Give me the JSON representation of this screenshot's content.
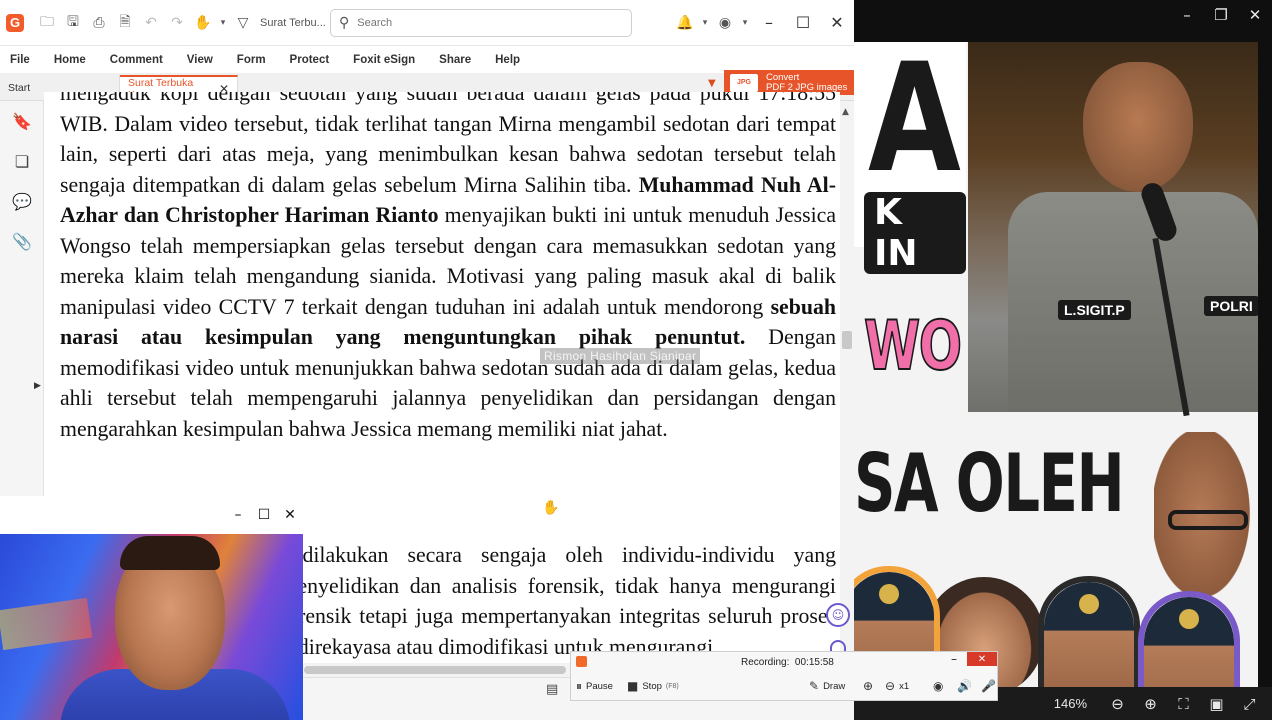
{
  "foxit": {
    "logo": "G",
    "doc_title": "Surat Terbu...",
    "search_placeholder": "Search",
    "menu": [
      "File",
      "Home",
      "Comment",
      "View",
      "Form",
      "Protect",
      "Foxit eSign",
      "Share",
      "Help"
    ],
    "tabs": {
      "start": "Start",
      "active": "Surat Terbuka Kep..."
    },
    "convert": {
      "line1": "Convert",
      "line2": "PDF 2 JPG images",
      "jpg_badge": "JPG"
    },
    "accent_color": "#e8542a"
  },
  "document": {
    "p1": [
      {
        "t": "mengaduk kopi dengan sedotan yang sudah berada dalam gelas pada pukul 17:18:55 WIB. Dalam video tersebut, tidak terlihat tangan Mirna mengambil sedotan dari tempat lain, seperti dari atas meja, yang menimbulkan kesan bahwa sedotan tersebut telah sengaja ditempatkan di dalam gelas sebelum Mirna Salihin tiba. ",
        "b": false
      },
      {
        "t": "Muhammad Nuh Al-Azhar dan Christopher Hariman Rianto",
        "b": true
      },
      {
        "t": " menyajikan bukti ini untuk menuduh Jessica Wongso telah mempersiapkan gelas tersebut dengan cara memasukkan sedotan yang mereka klaim telah mengandung sianida. Motivasi  yang paling masuk akal di balik manipulasi video CCTV 7 terkait dengan tuduhan ini adalah untuk mendorong ",
        "b": false
      },
      {
        "t": "sebuah narasi atau kesimpulan yang menguntungkan pihak penuntut.",
        "b": true
      },
      {
        "t": " Dengan memodifikasi video untuk menunjukkan bahwa sedotan sudah ada di dalam gelas, kedua ahli tersebut telah mempengaruhi jalannya penyelidikan dan persidangan dengan mengarahkan kesimpulan bahwa Jessica memang memiliki niat jahat.",
        "b": false
      }
    ],
    "p2": "Manipulasi bukti yang dilakukan secara sengaja oleh individu-individu yang bertanggung jawab atas penyelidikan dan analisis forensik, tidak hanya mengurangi kredibilitas laporan ahli forensik tetapi juga mempertanyakan integritas seluruh proses hukum. Fakta bahwa bukti direkayasa atau dimodifikasi untuk mengurangi",
    "watermark": "Rismon Hasiholan Sianipar"
  },
  "recorder": {
    "label": "Recording:",
    "time": "00:15:58",
    "pause": "Pause",
    "stop": "Stop",
    "stop_key": "(F8)",
    "draw": "Draw",
    "speed": "x1"
  },
  "viewer": {
    "zoom": "146%"
  },
  "background_image": {
    "letter": "A",
    "badge": "K IN",
    "pink_text": "WO",
    "caption": "SA OLEH",
    "name_tag": "L.SIGIT.P",
    "polri_tag": "POLRI"
  }
}
